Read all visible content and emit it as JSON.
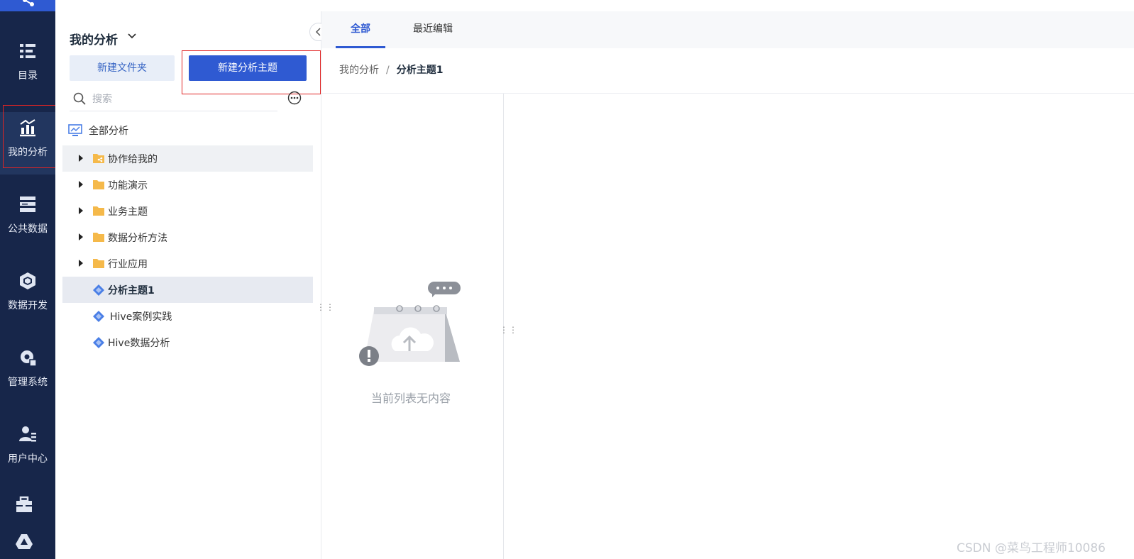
{
  "nav": {
    "items": [
      {
        "label": "目录",
        "icon": "catalog-icon"
      },
      {
        "label": "我的分析",
        "icon": "analysis-chart-icon"
      },
      {
        "label": "公共数据",
        "icon": "database-icon"
      },
      {
        "label": "数据开发",
        "icon": "cube-icon"
      },
      {
        "label": "管理系统",
        "icon": "settings-gear-icon"
      },
      {
        "label": "用户中心",
        "icon": "user-list-icon"
      }
    ],
    "bottom_icons": [
      "toolbox-icon",
      "drive-icon"
    ]
  },
  "panel": {
    "title": "我的分析",
    "new_folder_label": "新建文件夹",
    "new_theme_label": "新建分析主题",
    "search_placeholder": "搜索",
    "tree_root": "全部分析",
    "tree": [
      {
        "label": "协作给我的",
        "type": "shared-folder"
      },
      {
        "label": "功能演示",
        "type": "folder"
      },
      {
        "label": "业务主题",
        "type": "folder"
      },
      {
        "label": "数据分析方法",
        "type": "folder"
      },
      {
        "label": "行业应用",
        "type": "folder"
      },
      {
        "label": "分析主题1",
        "type": "theme",
        "selected": true
      },
      {
        "label": "Hive案例实践",
        "type": "theme"
      },
      {
        "label": "Hive数据分析",
        "type": "theme"
      }
    ]
  },
  "tabs": [
    {
      "label": "全部",
      "active": true
    },
    {
      "label": "最近编辑",
      "active": false
    }
  ],
  "breadcrumb": {
    "root": "我的分析",
    "separator": "/",
    "current": "分析主题1"
  },
  "empty_state": {
    "text": "当前列表无内容"
  },
  "watermark": "CSDN @菜鸟工程师10086",
  "colors": {
    "nav_bg": "#17264a",
    "primary": "#2f5ad2",
    "highlight_box": "#e02424",
    "folder": "#f5b94a",
    "theme_icon": "#4a7fe6"
  }
}
